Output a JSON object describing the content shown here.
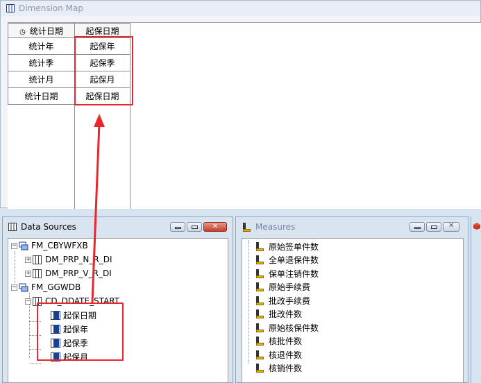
{
  "dimension_map": {
    "title": "Dimension Map",
    "header": {
      "col1": "统计日期",
      "col2": "起保日期",
      "col1_icon": "clock-icon"
    },
    "rows": [
      {
        "c1": "统计年",
        "c2": "起保年"
      },
      {
        "c1": "统计季",
        "c2": "起保季"
      },
      {
        "c1": "统计月",
        "c2": "起保月"
      },
      {
        "c1": "统计日期",
        "c2": "起保日期"
      }
    ]
  },
  "data_sources": {
    "title": "Data Sources",
    "close_label": "✕",
    "tree": [
      {
        "label": "FM_CBYWFXB",
        "icon": "database-icon"
      },
      {
        "label": "DM_PRP_N_R_DI",
        "icon": "table-icon"
      },
      {
        "label": "DM_PRP_V_R_DI",
        "icon": "table-icon"
      },
      {
        "label": "FM_GGWDB",
        "icon": "database-icon"
      },
      {
        "label": "CD_DDATE_START",
        "icon": "table-icon"
      },
      {
        "label": "起保日期",
        "icon": "field-icon"
      },
      {
        "label": "起保年",
        "icon": "field-icon"
      },
      {
        "label": "起保季",
        "icon": "field-icon"
      },
      {
        "label": "起保月",
        "icon": "field-icon"
      }
    ]
  },
  "measures": {
    "title": "Measures",
    "items": [
      "原始签单件数",
      "全单退保件数",
      "保单注销件数",
      "原始手续费",
      "批改手续费",
      "批改件数",
      "原始核保件数",
      "核批件数",
      "核退件数",
      "核销件数"
    ]
  },
  "colors": {
    "highlight": "#e8262c",
    "window_bg": "#d9e4f1"
  }
}
